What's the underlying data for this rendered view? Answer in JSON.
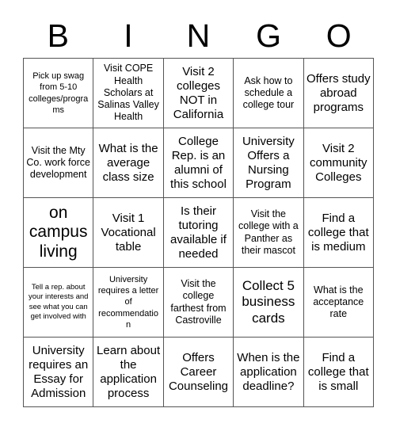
{
  "card": {
    "title": "BINGO",
    "header_letters": [
      "B",
      "I",
      "N",
      "G",
      "O"
    ],
    "columns": 5,
    "rows": 5,
    "border_color": "#555555",
    "text_color": "#000000",
    "background_color": "#ffffff",
    "cells": [
      {
        "text": "Pick up swag from 5-10 colleges/programs",
        "size": "fs-s"
      },
      {
        "text": "Visit COPE Health Scholars at Salinas Valley Health",
        "size": "fs-m"
      },
      {
        "text": "Visit 2 colleges NOT in California",
        "size": "fs-l"
      },
      {
        "text": "Ask how to schedule a college tour",
        "size": "fs-m"
      },
      {
        "text": "Offers study abroad programs",
        "size": "fs-l"
      },
      {
        "text": "Visit the Mty Co. work force development",
        "size": "fs-m"
      },
      {
        "text": "What is the average class size",
        "size": "fs-l"
      },
      {
        "text": "College Rep. is an alumni of this school",
        "size": "fs-l"
      },
      {
        "text": "University Offers a Nursing Program",
        "size": "fs-l"
      },
      {
        "text": "Visit 2 community Colleges",
        "size": "fs-l"
      },
      {
        "text": "on campus living",
        "size": "fs-xxl"
      },
      {
        "text": "Visit 1 Vocational table",
        "size": "fs-l"
      },
      {
        "text": "Is their tutoring available if needed",
        "size": "fs-l"
      },
      {
        "text": "Visit the college with a Panther as their mascot",
        "size": "fs-m"
      },
      {
        "text": "Find a college that is medium",
        "size": "fs-l"
      },
      {
        "text": "Tell a rep. about your interests and see what you can get involved with",
        "size": "fs-xs"
      },
      {
        "text": "University requires a letter of recommendation",
        "size": "fs-s"
      },
      {
        "text": "Visit the college farthest from Castroville",
        "size": "fs-m"
      },
      {
        "text": "Collect 5 business cards",
        "size": "fs-xl"
      },
      {
        "text": "What is the acceptance rate",
        "size": "fs-m"
      },
      {
        "text": "University requires an Essay for Admission",
        "size": "fs-l"
      },
      {
        "text": "Learn about the application process",
        "size": "fs-l"
      },
      {
        "text": "Offers Career Counseling",
        "size": "fs-l"
      },
      {
        "text": "When is the application deadline?",
        "size": "fs-l"
      },
      {
        "text": "Find a college that is small",
        "size": "fs-l"
      }
    ]
  }
}
